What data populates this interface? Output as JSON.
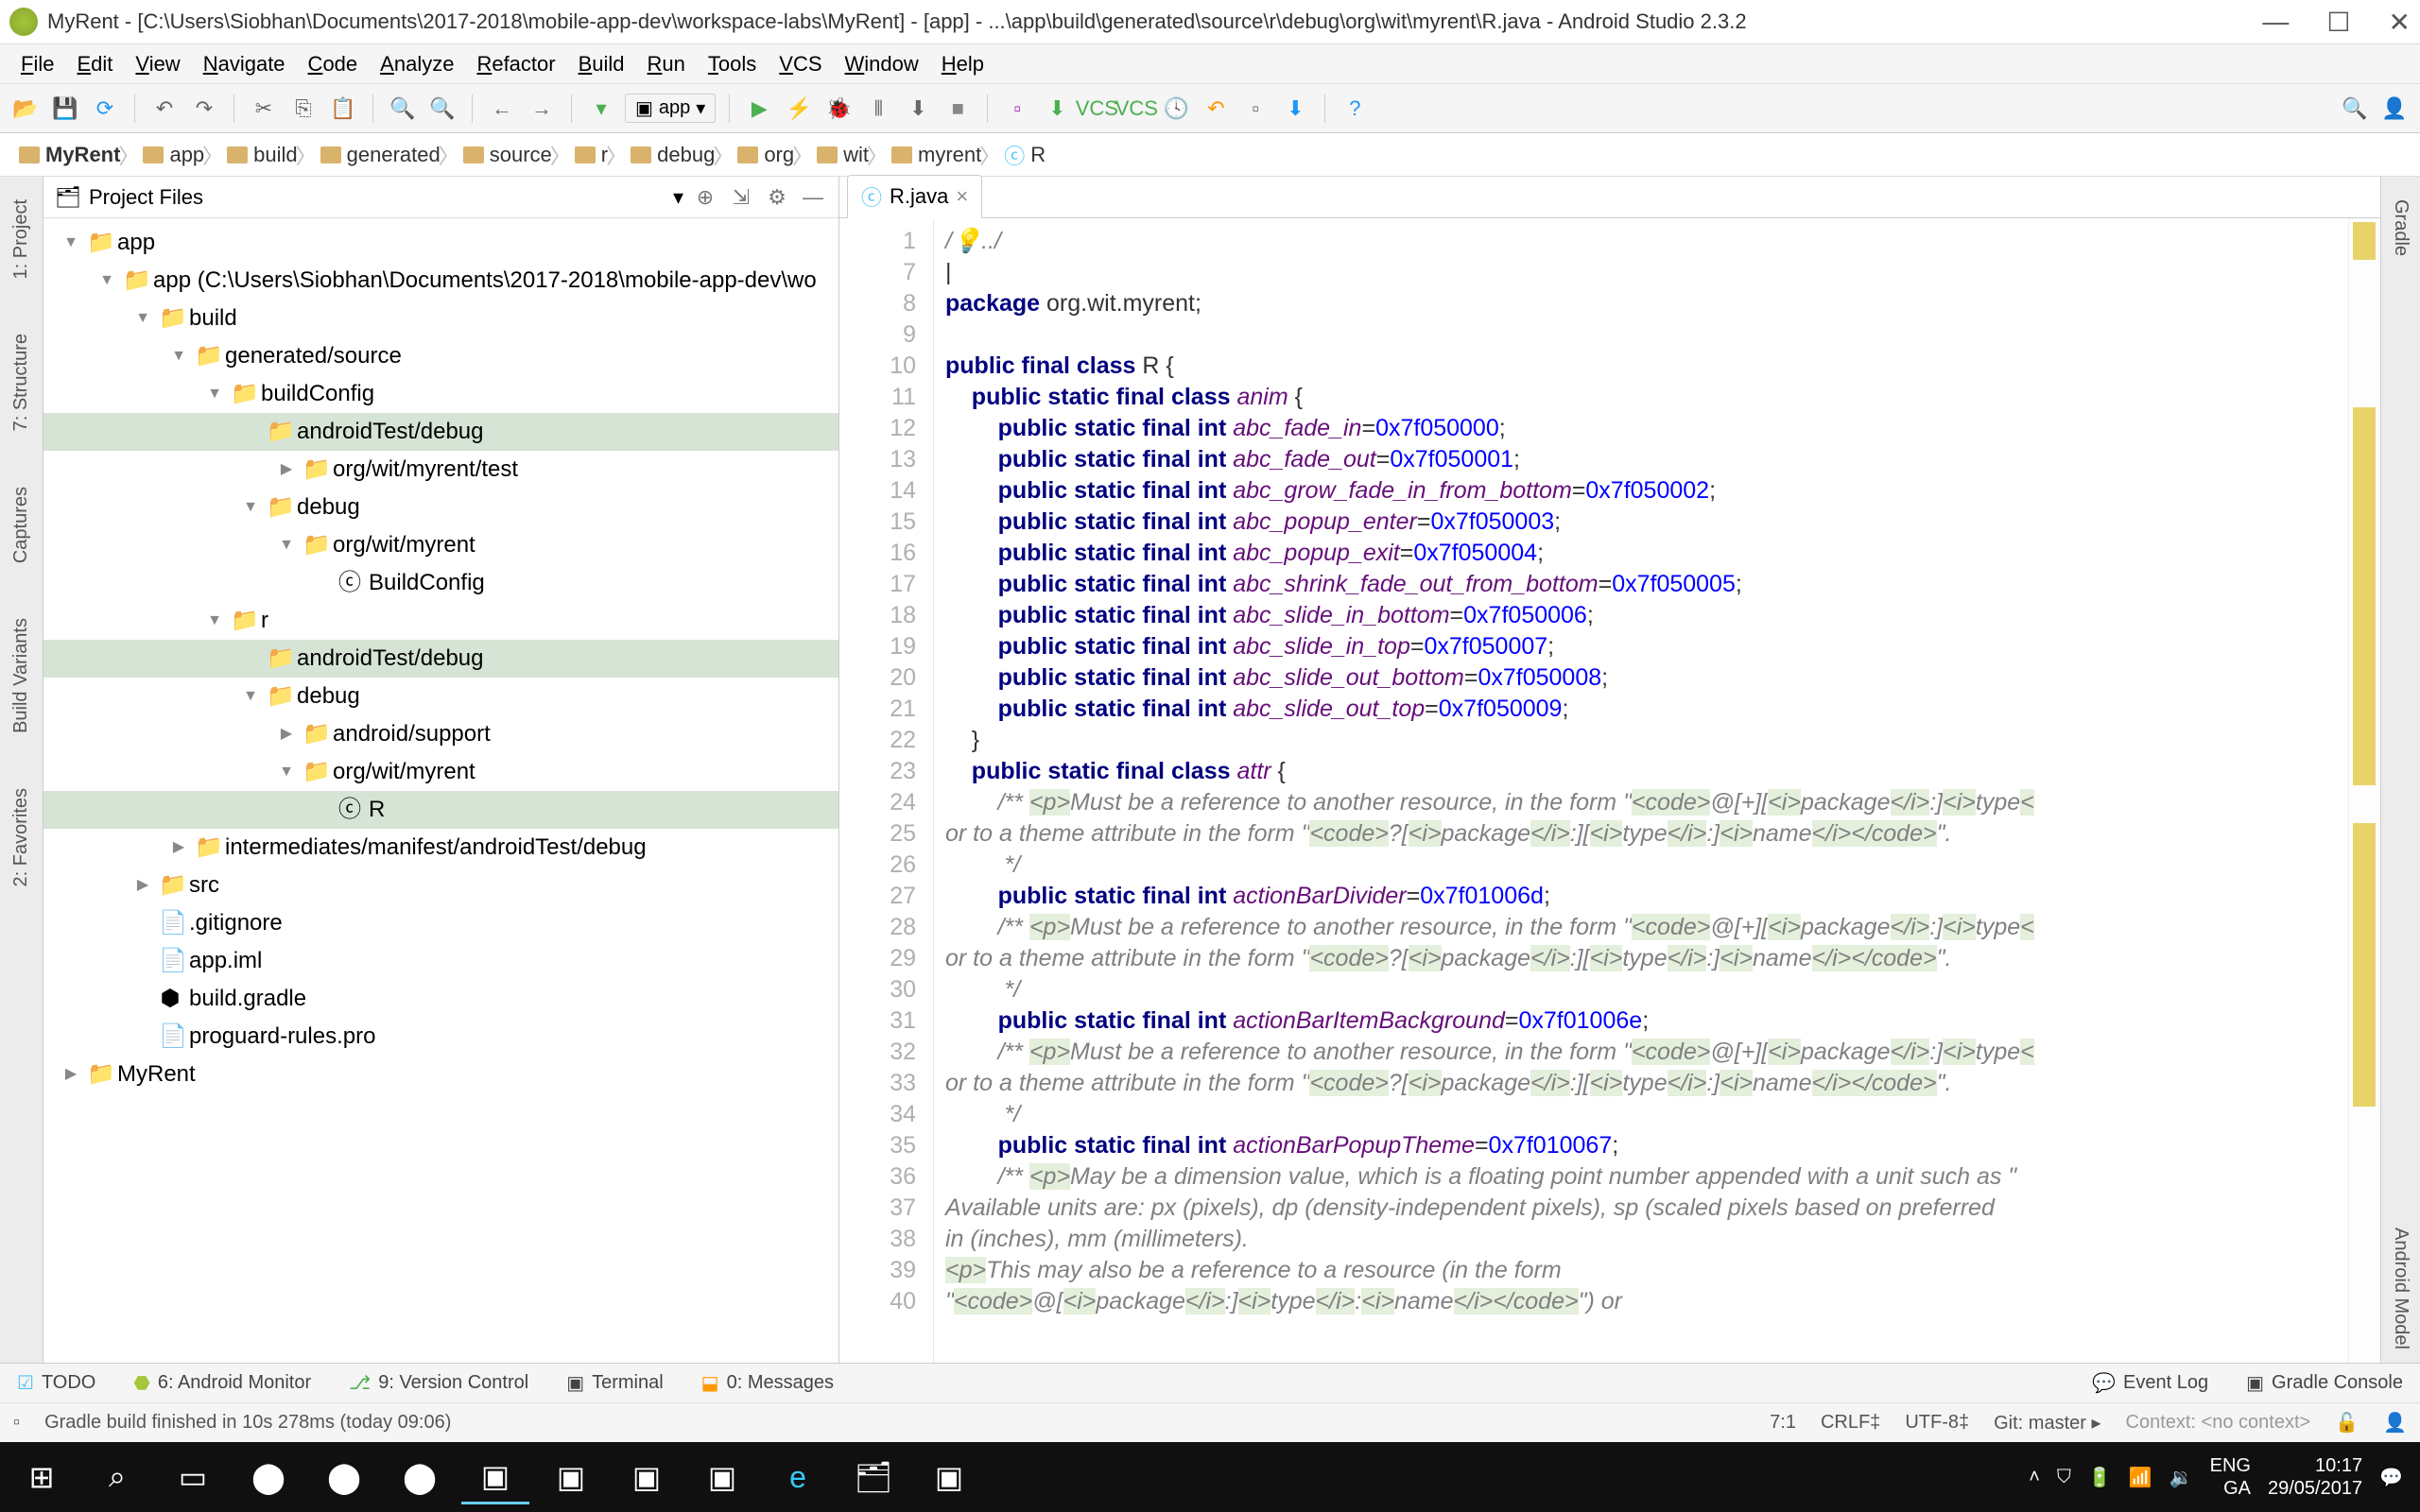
{
  "window": {
    "title": "MyRent - [C:\\Users\\Siobhan\\Documents\\2017-2018\\mobile-app-dev\\workspace-labs\\MyRent] - [app] - ...\\app\\build\\generated\\source\\r\\debug\\org\\wit\\myrent\\R.java - Android Studio 2.3.2"
  },
  "menu": [
    "File",
    "Edit",
    "View",
    "Navigate",
    "Code",
    "Analyze",
    "Refactor",
    "Build",
    "Run",
    "Tools",
    "VCS",
    "Window",
    "Help"
  ],
  "runConfig": "app",
  "breadcrumbs": [
    "MyRent",
    "app",
    "build",
    "generated",
    "source",
    "r",
    "debug",
    "org",
    "wit",
    "myrent",
    "R"
  ],
  "projectPanel": {
    "title": "Project Files"
  },
  "tree": [
    {
      "depth": 0,
      "arrow": "▼",
      "icon": "📁",
      "label": "app",
      "sel": false
    },
    {
      "depth": 1,
      "arrow": "▼",
      "icon": "📁",
      "label": "app (C:\\Users\\Siobhan\\Documents\\2017-2018\\mobile-app-dev\\wo",
      "sel": false
    },
    {
      "depth": 2,
      "arrow": "▼",
      "icon": "📁",
      "label": "build",
      "sel": false
    },
    {
      "depth": 3,
      "arrow": "▼",
      "icon": "📁",
      "label": "generated/source",
      "sel": false
    },
    {
      "depth": 4,
      "arrow": "▼",
      "icon": "📁",
      "label": "buildConfig",
      "sel": false
    },
    {
      "depth": 5,
      "arrow": "",
      "icon": "📁",
      "label": "androidTest/debug",
      "sel": true
    },
    {
      "depth": 6,
      "arrow": "▶",
      "icon": "📁",
      "label": "org/wit/myrent/test",
      "sel": false
    },
    {
      "depth": 5,
      "arrow": "▼",
      "icon": "📁",
      "label": "debug",
      "sel": false
    },
    {
      "depth": 6,
      "arrow": "▼",
      "icon": "📁",
      "label": "org/wit/myrent",
      "sel": false
    },
    {
      "depth": 7,
      "arrow": "",
      "icon": "ⓒ",
      "label": "BuildConfig",
      "sel": false
    },
    {
      "depth": 4,
      "arrow": "▼",
      "icon": "📁",
      "label": "r",
      "sel": false
    },
    {
      "depth": 5,
      "arrow": "",
      "icon": "📁",
      "label": "androidTest/debug",
      "sel": true
    },
    {
      "depth": 5,
      "arrow": "▼",
      "icon": "📁",
      "label": "debug",
      "sel": false
    },
    {
      "depth": 6,
      "arrow": "▶",
      "icon": "📁",
      "label": "android/support",
      "sel": false
    },
    {
      "depth": 6,
      "arrow": "▼",
      "icon": "📁",
      "label": "org/wit/myrent",
      "sel": false
    },
    {
      "depth": 7,
      "arrow": "",
      "icon": "ⓒ",
      "label": "R",
      "sel": true,
      "file": true
    },
    {
      "depth": 3,
      "arrow": "▶",
      "icon": "📁",
      "label": "intermediates/manifest/androidTest/debug",
      "sel": false
    },
    {
      "depth": 2,
      "arrow": "▶",
      "icon": "📁",
      "label": "src",
      "sel": false
    },
    {
      "depth": 2,
      "arrow": "",
      "icon": "📄",
      "label": ".gitignore",
      "sel": false
    },
    {
      "depth": 2,
      "arrow": "",
      "icon": "📄",
      "label": "app.iml",
      "sel": false
    },
    {
      "depth": 2,
      "arrow": "",
      "icon": "⬢",
      "label": "build.gradle",
      "sel": false
    },
    {
      "depth": 2,
      "arrow": "",
      "icon": "📄",
      "label": "proguard-rules.pro",
      "sel": false
    },
    {
      "depth": 0,
      "arrow": "▶",
      "icon": "📁",
      "label": "MyRent",
      "sel": false
    }
  ],
  "editorTab": {
    "label": "R.java"
  },
  "codeLines": [
    {
      "n": 1,
      "html": "<span class='cmt'>/💡../</span>"
    },
    {
      "n": 7,
      "html": "|"
    },
    {
      "n": 8,
      "html": "<span class='kw'>package</span> org.wit.myrent;"
    },
    {
      "n": 9,
      "html": ""
    },
    {
      "n": 10,
      "html": "<span class='kw'>public final class</span> R {"
    },
    {
      "n": 11,
      "html": "    <span class='kw'>public static final class</span> <span class='fld'>anim</span> {"
    },
    {
      "n": 12,
      "html": "        <span class='kw'>public static final int</span> <span class='fld'>abc_fade_in</span>=<span class='hex'>0x7f050000</span>;"
    },
    {
      "n": 13,
      "html": "        <span class='kw'>public static final int</span> <span class='fld'>abc_fade_out</span>=<span class='hex'>0x7f050001</span>;"
    },
    {
      "n": 14,
      "html": "        <span class='kw'>public static final int</span> <span class='fld'>abc_grow_fade_in_from_bottom</span>=<span class='hex'>0x7f050002</span>;"
    },
    {
      "n": 15,
      "html": "        <span class='kw'>public static final int</span> <span class='fld'>abc_popup_enter</span>=<span class='hex'>0x7f050003</span>;"
    },
    {
      "n": 16,
      "html": "        <span class='kw'>public static final int</span> <span class='fld'>abc_popup_exit</span>=<span class='hex'>0x7f050004</span>;"
    },
    {
      "n": 17,
      "html": "        <span class='kw'>public static final int</span> <span class='fld'>abc_shrink_fade_out_from_bottom</span>=<span class='hex'>0x7f050005</span>;"
    },
    {
      "n": 18,
      "html": "        <span class='kw'>public static final int</span> <span class='fld'>abc_slide_in_bottom</span>=<span class='hex'>0x7f050006</span>;"
    },
    {
      "n": 19,
      "html": "        <span class='kw'>public static final int</span> <span class='fld'>abc_slide_in_top</span>=<span class='hex'>0x7f050007</span>;"
    },
    {
      "n": 20,
      "html": "        <span class='kw'>public static final int</span> <span class='fld'>abc_slide_out_bottom</span>=<span class='hex'>0x7f050008</span>;"
    },
    {
      "n": 21,
      "html": "        <span class='kw'>public static final int</span> <span class='fld'>abc_slide_out_top</span>=<span class='hex'>0x7f050009</span>;"
    },
    {
      "n": 22,
      "html": "    }"
    },
    {
      "n": 23,
      "html": "    <span class='kw'>public static final class</span> <span class='fld'>attr</span> {"
    },
    {
      "n": 24,
      "html": "        <span class='cmt'>/** <span class='tagc'>&lt;p&gt;</span>Must be a reference to another resource, in the form \"<span class='tagc'>&lt;code&gt;</span>@[+][<span class='tagc'>&lt;i&gt;</span>package<span class='tagc'>&lt;/i&gt;</span>:]<span class='tagc'>&lt;i&gt;</span>type<span class='tagc'>&lt;</span></span>"
    },
    {
      "n": 25,
      "html": "<span class='cmt'>or to a theme attribute in the form \"<span class='tagc'>&lt;code&gt;</span>?[<span class='tagc'>&lt;i&gt;</span>package<span class='tagc'>&lt;/i&gt;</span>:][<span class='tagc'>&lt;i&gt;</span>type<span class='tagc'>&lt;/i&gt;</span>:]<span class='tagc'>&lt;i&gt;</span>name<span class='tagc'>&lt;/i&gt;&lt;/code&gt;</span>\".</span>"
    },
    {
      "n": 26,
      "html": "         <span class='cmt'>*/</span>"
    },
    {
      "n": 27,
      "html": "        <span class='kw'>public static final int</span> <span class='fld'>actionBarDivider</span>=<span class='hex'>0x7f01006d</span>;"
    },
    {
      "n": 28,
      "html": "        <span class='cmt'>/** <span class='tagc'>&lt;p&gt;</span>Must be a reference to another resource, in the form \"<span class='tagc'>&lt;code&gt;</span>@[+][<span class='tagc'>&lt;i&gt;</span>package<span class='tagc'>&lt;/i&gt;</span>:]<span class='tagc'>&lt;i&gt;</span>type<span class='tagc'>&lt;</span></span>"
    },
    {
      "n": 29,
      "html": "<span class='cmt'>or to a theme attribute in the form \"<span class='tagc'>&lt;code&gt;</span>?[<span class='tagc'>&lt;i&gt;</span>package<span class='tagc'>&lt;/i&gt;</span>:][<span class='tagc'>&lt;i&gt;</span>type<span class='tagc'>&lt;/i&gt;</span>:]<span class='tagc'>&lt;i&gt;</span>name<span class='tagc'>&lt;/i&gt;&lt;/code&gt;</span>\".</span>"
    },
    {
      "n": 30,
      "html": "         <span class='cmt'>*/</span>"
    },
    {
      "n": 31,
      "html": "        <span class='kw'>public static final int</span> <span class='fld'>actionBarItemBackground</span>=<span class='hex'>0x7f01006e</span>;"
    },
    {
      "n": 32,
      "html": "        <span class='cmt'>/** <span class='tagc'>&lt;p&gt;</span>Must be a reference to another resource, in the form \"<span class='tagc'>&lt;code&gt;</span>@[+][<span class='tagc'>&lt;i&gt;</span>package<span class='tagc'>&lt;/i&gt;</span>:]<span class='tagc'>&lt;i&gt;</span>type<span class='tagc'>&lt;</span></span>"
    },
    {
      "n": 33,
      "html": "<span class='cmt'>or to a theme attribute in the form \"<span class='tagc'>&lt;code&gt;</span>?[<span class='tagc'>&lt;i&gt;</span>package<span class='tagc'>&lt;/i&gt;</span>:][<span class='tagc'>&lt;i&gt;</span>type<span class='tagc'>&lt;/i&gt;</span>:]<span class='tagc'>&lt;i&gt;</span>name<span class='tagc'>&lt;/i&gt;&lt;/code&gt;</span>\".</span>"
    },
    {
      "n": 34,
      "html": "         <span class='cmt'>*/</span>"
    },
    {
      "n": 35,
      "html": "        <span class='kw'>public static final int</span> <span class='fld'>actionBarPopupTheme</span>=<span class='hex'>0x7f010067</span>;"
    },
    {
      "n": 36,
      "html": "        <span class='cmt'>/** <span class='tagc'>&lt;p&gt;</span>May be a dimension value, which is a floating point number appended with a unit such as \"</span>"
    },
    {
      "n": 37,
      "html": "<span class='cmt'>Available units are: px (pixels), dp (density-independent pixels), sp (scaled pixels based on preferred</span>"
    },
    {
      "n": 38,
      "html": "<span class='cmt'>in (inches), mm (millimeters).</span>"
    },
    {
      "n": 39,
      "html": "<span class='cmt'><span class='tagc'>&lt;p&gt;</span>This may also be a reference to a resource (in the form</span>"
    },
    {
      "n": 40,
      "html": "<span class='cmt'>\"<span class='tagc'>&lt;code&gt;</span>@[<span class='tagc'>&lt;i&gt;</span>package<span class='tagc'>&lt;/i&gt;</span>:]<span class='tagc'>&lt;i&gt;</span>type<span class='tagc'>&lt;/i&gt;</span>:<span class='tagc'>&lt;i&gt;</span>name<span class='tagc'>&lt;/i&gt;&lt;/code&gt;</span>\") or</span>"
    }
  ],
  "bottomTools": {
    "todo": "TODO",
    "android": "6: Android Monitor",
    "vcs": "9: Version Control",
    "terminal": "Terminal",
    "messages": "0: Messages",
    "eventlog": "Event Log",
    "gradle": "Gradle Console"
  },
  "status": {
    "msg": "Gradle build finished in 10s 278ms (today 09:06)",
    "pos": "7:1",
    "enc": "CRLF‡",
    "charset": "UTF-8‡",
    "git": "Git: master ▸",
    "ctx": "Context: <no context>"
  },
  "leftTabs": [
    "1: Project",
    "7: Structure",
    "Captures",
    "Build Variants",
    "2: Favorites"
  ],
  "rightTabs": [
    "Gradle",
    "Android Model"
  ],
  "tray": {
    "lang1": "ENG",
    "lang2": "GA",
    "time": "10:17",
    "date": "29/05/2017"
  }
}
